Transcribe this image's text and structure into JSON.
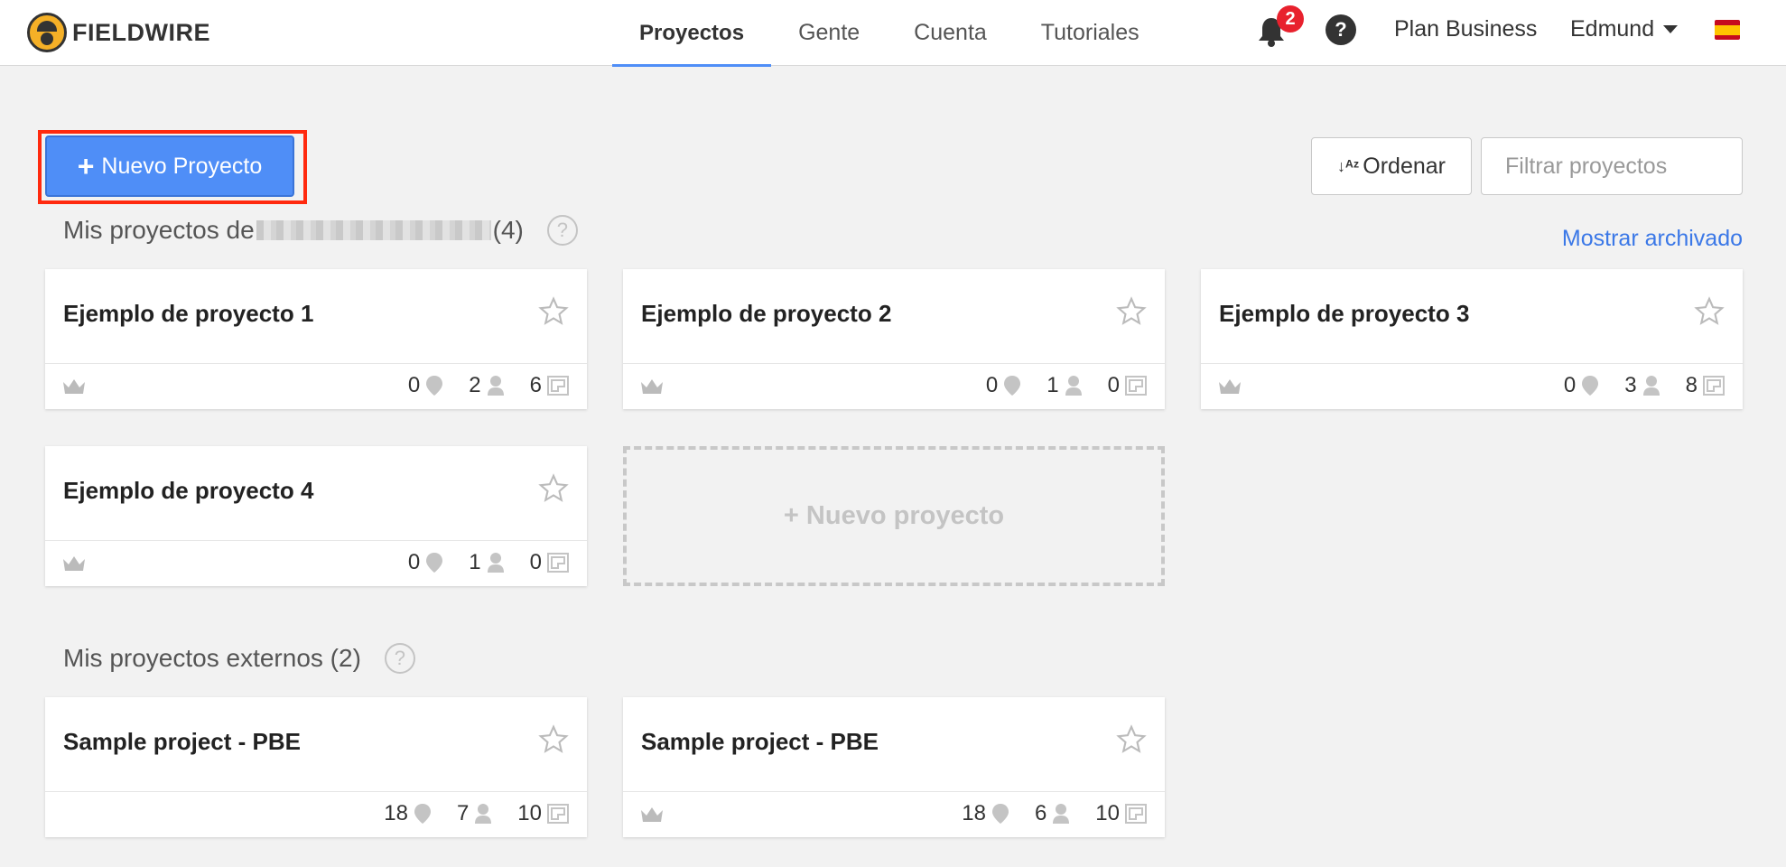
{
  "app": {
    "logo_text": "FIELDWIRE"
  },
  "nav": {
    "tabs": [
      {
        "label": "Proyectos"
      },
      {
        "label": "Gente"
      },
      {
        "label": "Cuenta"
      },
      {
        "label": "Tutoriales"
      }
    ]
  },
  "header": {
    "notification_count": "2",
    "help": "?",
    "plan": "Plan Business",
    "user": "Edmund"
  },
  "toolbar": {
    "new_project": "Nuevo Proyecto",
    "sort": "Ordenar",
    "sort_icon": "↓ᴬᶻ",
    "filter_placeholder": "Filtrar proyectos"
  },
  "sections": {
    "mine": {
      "title_prefix": "Mis proyectos de",
      "count": "(4)",
      "show_archived": "Mostrar archivado"
    },
    "external": {
      "title": "Mis proyectos externos (2)"
    }
  },
  "projects": [
    {
      "name": "Ejemplo de proyecto 1",
      "pins": "0",
      "people": "2",
      "plans": "6",
      "owner": true
    },
    {
      "name": "Ejemplo de proyecto 2",
      "pins": "0",
      "people": "1",
      "plans": "0",
      "owner": true
    },
    {
      "name": "Ejemplo de proyecto 3",
      "pins": "0",
      "people": "3",
      "plans": "8",
      "owner": true
    },
    {
      "name": "Ejemplo de proyecto 4",
      "pins": "0",
      "people": "1",
      "plans": "0",
      "owner": true
    }
  ],
  "new_project_card": "+ Nuevo proyecto",
  "external_projects": [
    {
      "name": "Sample project - PBE",
      "pins": "18",
      "people": "7",
      "plans": "10",
      "owner": false
    },
    {
      "name": "Sample project - PBE",
      "pins": "18",
      "people": "6",
      "plans": "10",
      "owner": true
    }
  ],
  "colors": {
    "accent": "#4f8ef7",
    "highlight": "#ff2a0f",
    "badge": "#e8212d",
    "link": "#3b78e7"
  }
}
